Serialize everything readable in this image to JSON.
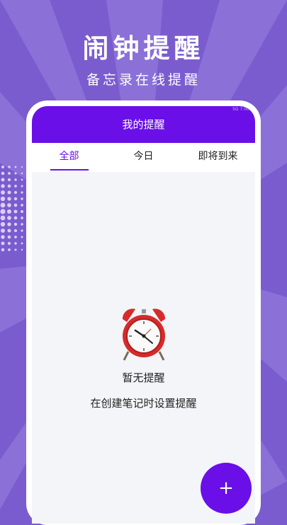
{
  "promo": {
    "headline": "闹钟提醒",
    "subline": "备忘录在线提醒"
  },
  "app": {
    "title": "我的提醒",
    "status_text": "5G 7:00"
  },
  "tabs": [
    {
      "label": "全部",
      "active": true
    },
    {
      "label": "今日",
      "active": false
    },
    {
      "label": "即将到来",
      "active": false
    }
  ],
  "empty_state": {
    "icon": "alarm-clock-icon",
    "title": "暂无提醒",
    "hint": "在创建笔记时设置提醒"
  },
  "fab": {
    "label": "+",
    "icon": "plus-icon"
  },
  "colors": {
    "background": "#7a5ccf",
    "accent": "#6a0fe8",
    "screen_bg": "#f3f5f8",
    "clock_red": "#d62b2b"
  }
}
